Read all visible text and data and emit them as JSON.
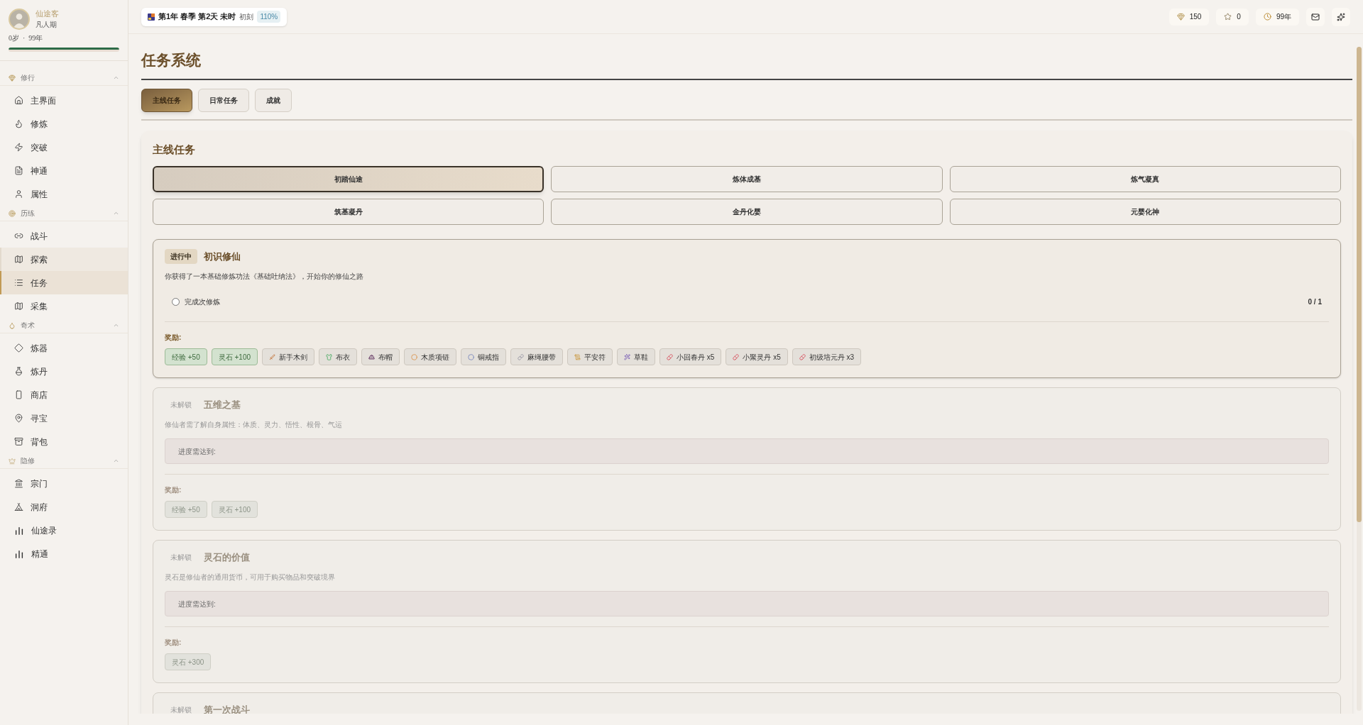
{
  "sidebar": {
    "profile": {
      "name": "仙途客",
      "realm": "凡人期",
      "age": "0岁",
      "separator": "·",
      "lifespan": "99年",
      "level": 1
    },
    "sections": [
      {
        "title": "修行",
        "expanded": true,
        "items": [
          {
            "label": "主界面",
            "selected": false,
            "hovered": false
          },
          {
            "label": "修炼",
            "selected": false,
            "hovered": false
          },
          {
            "label": "突破",
            "selected": false,
            "hovered": false
          },
          {
            "label": "神通",
            "selected": false,
            "hovered": false
          },
          {
            "label": "属性",
            "selected": false,
            "hovered": false
          }
        ]
      },
      {
        "title": "历练",
        "expanded": true,
        "items": [
          {
            "label": "战斗",
            "selected": false,
            "hovered": false
          },
          {
            "label": "探索",
            "selected": false,
            "hovered": true
          },
          {
            "label": "任务",
            "selected": true,
            "hovered": false
          },
          {
            "label": "采集",
            "selected": false,
            "hovered": false
          }
        ]
      },
      {
        "title": "奇术",
        "expanded": true,
        "items": [
          {
            "label": "炼器",
            "selected": false,
            "hovered": false
          },
          {
            "label": "炼丹",
            "selected": false,
            "hovered": false
          },
          {
            "label": "商店",
            "selected": false,
            "hovered": false
          },
          {
            "label": "寻宝",
            "selected": false,
            "hovered": false
          },
          {
            "label": "背包",
            "selected": false,
            "hovered": false
          }
        ]
      },
      {
        "title": "隐修",
        "expanded": true,
        "items": [
          {
            "label": "宗门",
            "selected": false,
            "hovered": false
          },
          {
            "label": "洞府",
            "selected": false,
            "hovered": false
          },
          {
            "label": "仙途录",
            "selected": false,
            "hovered": false
          },
          {
            "label": "精通",
            "selected": false,
            "hovered": false
          }
        ]
      }
    ]
  },
  "top_bar": {
    "date": "第1年 春季 第2天 未时",
    "period": "初刻",
    "speed": "110%",
    "stats": [
      "150",
      "0",
      "99年"
    ]
  },
  "page_title": "任务系统",
  "tabs": [
    {
      "label": "主线任务",
      "selected": true
    },
    {
      "label": "日常任务",
      "selected": false
    },
    {
      "label": "成就",
      "selected": false
    }
  ],
  "panel": {
    "title": "主线任务",
    "stages": [
      {
        "label": "初踏仙途",
        "selected": true
      },
      {
        "label": "炼体成基",
        "selected": false
      },
      {
        "label": "炼气凝真",
        "selected": false
      },
      {
        "label": "筑基凝丹",
        "selected": false
      },
      {
        "label": "金丹化婴",
        "selected": false
      },
      {
        "label": "元婴化神",
        "selected": false
      }
    ],
    "quests": [
      {
        "status": "进行中",
        "active": true,
        "title": "初识修仙",
        "description": "你获得了一本基础修炼功法《基础吐纳法》，开始你的修仙之路",
        "objectives": [
          {
            "label": "完成次修炼",
            "checked": false,
            "count": "0 / 1"
          }
        ],
        "rewards_label": "奖励:",
        "rewards": [
          {
            "kind": "stat",
            "label": "经验 +50"
          },
          {
            "kind": "stat",
            "label": "灵石 +100"
          },
          {
            "kind": "item",
            "label": "新手木剑"
          },
          {
            "kind": "item",
            "label": "布衣"
          },
          {
            "kind": "item",
            "label": "布帽"
          },
          {
            "kind": "item",
            "label": "木质项链"
          },
          {
            "kind": "item",
            "label": "铜戒指"
          },
          {
            "kind": "item",
            "label": "麻绳腰带"
          },
          {
            "kind": "item",
            "label": "平安符"
          },
          {
            "kind": "item",
            "label": "草鞋"
          },
          {
            "kind": "item",
            "label": "小回春丹 x5"
          },
          {
            "kind": "item",
            "label": "小聚灵丹 x5"
          },
          {
            "kind": "item",
            "label": "初级培元丹 x3"
          }
        ]
      },
      {
        "status": "未解锁",
        "active": false,
        "title": "五维之基",
        "description": "修仙者需了解自身属性：体质、灵力、悟性、根骨、气运",
        "progress_label": "进度需达到:",
        "rewards_label": "奖励:",
        "rewards": [
          {
            "kind": "stat",
            "label": "经验 +50"
          },
          {
            "kind": "stat",
            "label": "灵石 +100"
          }
        ]
      },
      {
        "status": "未解锁",
        "active": false,
        "title": "灵石的价值",
        "description": "灵石是修仙者的通用货币，可用于购买物品和突破境界",
        "progress_label": "进度需达到:",
        "rewards_label": "奖励:",
        "rewards": [
          {
            "kind": "stat",
            "label": "灵石 +300"
          }
        ]
      },
      {
        "status": "未解锁",
        "active": false,
        "title": "第一次战斗"
      }
    ]
  }
}
